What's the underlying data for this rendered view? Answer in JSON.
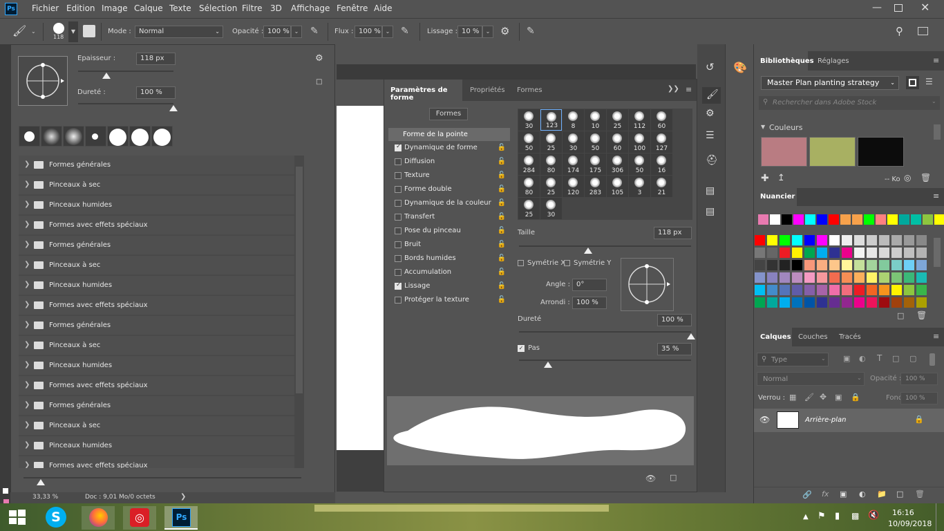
{
  "app": {
    "logo": "Ps"
  },
  "menu": [
    "Fichier",
    "Edition",
    "Image",
    "Calque",
    "Texte",
    "Sélection",
    "Filtre",
    "3D",
    "Affichage",
    "Fenêtre",
    "Aide"
  ],
  "options_bar": {
    "brush_size": "118",
    "mode_label": "Mode :",
    "mode_value": "Normal",
    "opacity_label": "Opacité :",
    "opacity_value": "100 %",
    "flow_label": "Flux :",
    "flow_value": "100 %",
    "smoothing_label": "Lissage :",
    "smoothing_value": "10 %"
  },
  "picker": {
    "size_label": "Epaisseur :",
    "size_value": "118 px",
    "size_level": 0.3,
    "hardness_label": "Dureté :",
    "hardness_value": "100 %",
    "hardness_level": 1.0,
    "folders": [
      "Formes générales",
      "Pinceaux à sec",
      "Pinceaux humides",
      "Formes avec effets spéciaux",
      "Formes générales",
      "Pinceaux à sec",
      "Pinceaux humides",
      "Formes avec effets spéciaux",
      "Formes générales",
      "Pinceaux à sec",
      "Pinceaux humides",
      "Formes avec effets spéciaux",
      "Formes générales",
      "Pinceaux à sec",
      "Pinceaux humides",
      "Formes avec effets spéciaux"
    ]
  },
  "status_bar": {
    "zoom": "33,33 %",
    "doc": "Doc : 9,01 Mo/0 octets"
  },
  "brush_settings": {
    "tabs": [
      "Paramètres de forme",
      "Propriétés",
      "Formes"
    ],
    "formes_button": "Formes",
    "tip_shape": "Forme de la pointe",
    "options": [
      {
        "label": "Dynamique de forme",
        "checked": true
      },
      {
        "label": "Diffusion",
        "checked": false
      },
      {
        "label": "Texture",
        "checked": false
      },
      {
        "label": "Forme double",
        "checked": false
      },
      {
        "label": "Dynamique de la couleur",
        "checked": false
      },
      {
        "label": "Transfert",
        "checked": false
      },
      {
        "label": "Pose du pinceau",
        "checked": false
      },
      {
        "label": "Bruit",
        "checked": false
      },
      {
        "label": "Bords humides",
        "checked": false
      },
      {
        "label": "Accumulation",
        "checked": false
      },
      {
        "label": "Lissage",
        "checked": true
      },
      {
        "label": "Protéger la texture",
        "checked": false
      }
    ],
    "tip_sizes": [
      "30",
      "123",
      "8",
      "10",
      "25",
      "112",
      "60",
      "50",
      "25",
      "30",
      "50",
      "60",
      "100",
      "127",
      "284",
      "80",
      "174",
      "175",
      "306",
      "50",
      "16",
      "80",
      "25",
      "120",
      "283",
      "105",
      "3",
      "21",
      "25",
      "30"
    ],
    "size_label": "Taille",
    "size_value": "118 px",
    "size_level": 0.4,
    "flip_x": "Symétrie X",
    "flip_y": "Symétrie Y",
    "angle_label": "Angle :",
    "angle_value": "0°",
    "roundness_label": "Arrondi :",
    "roundness_value": "100 %",
    "hardness_label": "Dureté",
    "hardness_value": "100 %",
    "hardness_level": 1.0,
    "spacing_label": "Pas",
    "spacing_value": "35 %",
    "spacing_level": 0.17
  },
  "libraries": {
    "tabs": [
      "Bibliothèques",
      "Réglages"
    ],
    "library_name": "Master Plan planting strategy",
    "search_placeholder": "Rechercher dans Adobe Stock",
    "colors_header": "Couleurs",
    "color_swatches": [
      "#b97c82",
      "#a8b062",
      "#0c0c0c"
    ],
    "storage": "-- Ko"
  },
  "swatches": {
    "title": "Nuancier",
    "top_row": [
      "#e87ab0",
      "#ffffff",
      "#000000",
      "#ff00ff",
      "#00ffff",
      "#0000ff",
      "#ff0000",
      "#f7a14b",
      "#f7a14b",
      "#00ff00",
      "#ff8080",
      "#ffff00",
      "#00a99d",
      "#00bfa5",
      "#8dc63f",
      "#ffff00"
    ],
    "rows": [
      [
        "#ff0000",
        "#ffff00",
        "#00ff00",
        "#00ffff",
        "#0000ff",
        "#ff00ff",
        "#ffffff",
        "#eeeeee",
        "#dddddd",
        "#cccccc",
        "#bbbbbb",
        "#aaaaaa",
        "#999999",
        "#888888"
      ],
      [
        "#777777",
        "#666666",
        "#ee1c24",
        "#fff200",
        "#00a651",
        "#00aeef",
        "#2e3192",
        "#ec008c",
        "#f3f3f3",
        "#e6e6e6",
        "#d9d9d9",
        "#cdcdcd",
        "#c0c0c0",
        "#b3b3b3"
      ],
      [
        "#444444",
        "#333333",
        "#222222",
        "#000000",
        "#f7977a",
        "#f9ad81",
        "#fdc68a",
        "#fff79a",
        "#c4df9b",
        "#a3d39c",
        "#82ca9d",
        "#7bcdc8",
        "#6ecff6",
        "#7ea7d8"
      ],
      [
        "#8493ca",
        "#8882be",
        "#a187be",
        "#bc8dbf",
        "#f49ac2",
        "#f6989d",
        "#f26c4f",
        "#f68e55",
        "#fbaf5c",
        "#fff467",
        "#acd372",
        "#7cc576",
        "#3bb878",
        "#1abbb4"
      ],
      [
        "#00bff3",
        "#438ccb",
        "#5574b9",
        "#605ca8",
        "#855fa8",
        "#a763a8",
        "#f06ea9",
        "#f26d7d",
        "#ed1c24",
        "#f26522",
        "#f7941d",
        "#fff200",
        "#8dc63f",
        "#39b54a"
      ],
      [
        "#00a651",
        "#00a99d",
        "#00aeef",
        "#0072bc",
        "#0054a6",
        "#2e3192",
        "#662d91",
        "#92278f",
        "#ec008c",
        "#ed145b",
        "#9e0b0f",
        "#a0410d",
        "#a36209",
        "#aba000"
      ]
    ]
  },
  "layers": {
    "tabs": [
      "Calques",
      "Couches",
      "Tracés"
    ],
    "filter_placeholder": "Type",
    "blend_mode": "Normal",
    "opacity_label": "Opacité :",
    "opacity_value": "100 %",
    "lock_label": "Verrou :",
    "fill_label": "Fond :",
    "fill_value": "100 %",
    "layer_name": "Arrière-plan"
  },
  "taskbar": {
    "time": "16:16",
    "date": "10/09/2018"
  }
}
